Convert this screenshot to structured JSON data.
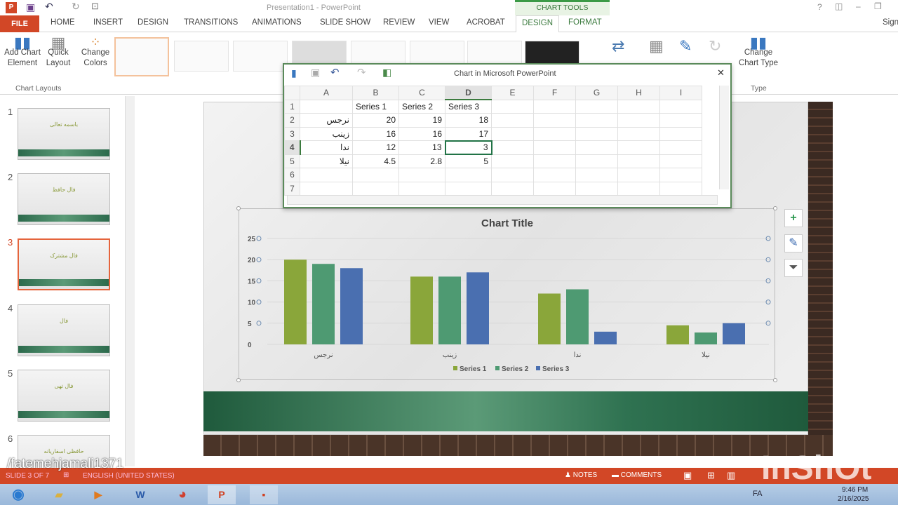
{
  "window": {
    "title": "Presentation1 - PowerPoint",
    "help": "?",
    "sign_in": "Sign"
  },
  "tabs": {
    "file": "FILE",
    "items": [
      "HOME",
      "INSERT",
      "DESIGN",
      "TRANSITIONS",
      "ANIMATIONS",
      "SLIDE SHOW",
      "REVIEW",
      "VIEW",
      "ACROBAT"
    ],
    "context_group": "CHART TOOLS",
    "context_tabs": [
      "DESIGN",
      "FORMAT"
    ]
  },
  "ribbon": {
    "add_chart_element": "Add Chart Element",
    "quick_layout": "Quick Layout",
    "change_colors": "Change Colors",
    "group_chart_layouts": "Chart Layouts",
    "change_chart_type": "Change Chart Type",
    "group_type": "Type"
  },
  "slides": [
    {
      "num": "1",
      "title": "باسمه تعالی"
    },
    {
      "num": "2",
      "title": "فال حافظ"
    },
    {
      "num": "3",
      "title": "فال مشترک"
    },
    {
      "num": "4",
      "title": "فال"
    },
    {
      "num": "5",
      "title": "فال تهی"
    },
    {
      "num": "6",
      "title": "حافظی اسفاریانه"
    }
  ],
  "excel": {
    "title": "Chart in Microsoft PowerPoint",
    "close": "✕",
    "columns": [
      "A",
      "B",
      "C",
      "D",
      "E",
      "F",
      "G",
      "H",
      "I"
    ],
    "rows": [
      "1",
      "2",
      "3",
      "4",
      "5",
      "6",
      "7"
    ],
    "cells": [
      [
        "",
        "Series 1",
        "Series 2",
        "Series 3"
      ],
      [
        "نرجس",
        "20",
        "19",
        "18"
      ],
      [
        "زینب",
        "16",
        "16",
        "17"
      ],
      [
        "ندا",
        "12",
        "13",
        "3"
      ],
      [
        "نیلا",
        "4.5",
        "2.8",
        "5"
      ],
      [
        "",
        "",
        "",
        ""
      ],
      [
        "",
        "",
        "",
        ""
      ]
    ]
  },
  "chart_data": {
    "type": "bar",
    "title": "Chart Title",
    "categories": [
      "نرجس",
      "زینب",
      "ندا",
      "نیلا"
    ],
    "series": [
      {
        "name": "Series 1",
        "values": [
          20,
          16,
          12,
          4.5
        ],
        "color": "#8aa63a"
      },
      {
        "name": "Series 2",
        "values": [
          19,
          16,
          13,
          2.8
        ],
        "color": "#4e9a72"
      },
      {
        "name": "Series 3",
        "values": [
          18,
          17,
          3,
          5
        ],
        "color": "#4a6fb0"
      }
    ],
    "yticks": [
      0,
      5,
      10,
      15,
      20,
      25
    ],
    "ylim": [
      0,
      25
    ],
    "legend": "bottom",
    "grid": true
  },
  "status": {
    "slide": "SLIDE 3 OF 7",
    "lang": "ENGLISH (UNITED STATES)",
    "notes": "NOTES",
    "comments": "COMMENTS",
    "watermark": "/fatemehjamali1371",
    "brand": "InShOt"
  },
  "taskbar": {
    "lang": "FA",
    "time": "9:46 PM",
    "date": "2/16/2025"
  }
}
